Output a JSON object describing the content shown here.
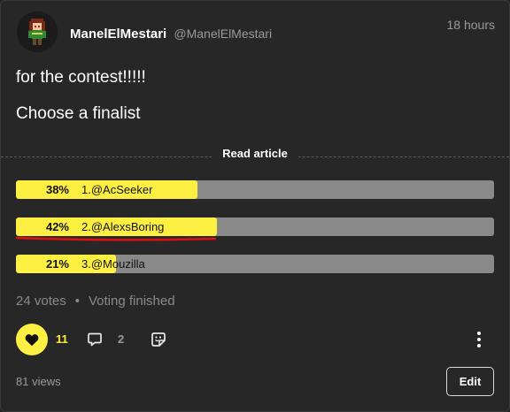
{
  "post": {
    "author_name": "ManelElMestari",
    "author_handle": "@ManelElMestari",
    "timestamp": "18 hours",
    "title": "for the contest!!!!!",
    "subtitle": "Choose a finalist",
    "read_article_label": "Read article"
  },
  "poll": {
    "options": [
      {
        "percent_label": "38%",
        "label": "1.@AcSeeker",
        "percent": 38,
        "winner": false
      },
      {
        "percent_label": "42%",
        "label": "2.@AlexsBoring",
        "percent": 42,
        "winner": true
      },
      {
        "percent_label": "21%",
        "label": "3.@Mouzilla",
        "percent": 21,
        "winner": false
      }
    ],
    "votes_label": "24 votes",
    "separator": "•",
    "status_label": "Voting finished"
  },
  "actions": {
    "like_count": "11",
    "comment_count": "2",
    "views_label": "81 views",
    "edit_label": "Edit"
  },
  "colors": {
    "accent": "#fdf043",
    "bar_track": "#898989",
    "winner_underline": "#e01010",
    "background": "#272727"
  },
  "icons": [
    "avatar",
    "heart-icon",
    "comment-icon",
    "sticker-icon",
    "more-vertical-icon"
  ]
}
